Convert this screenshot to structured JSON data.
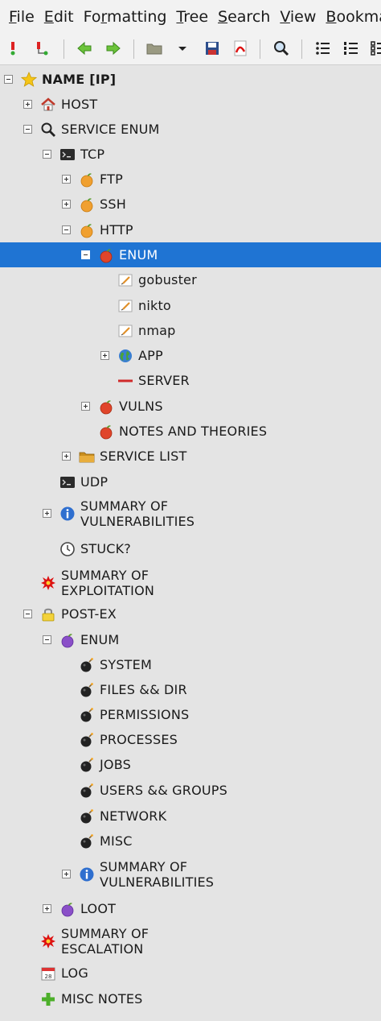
{
  "menubar": {
    "items": [
      {
        "key": "F",
        "rest": "ile"
      },
      {
        "key": "E",
        "rest": "dit"
      },
      {
        "pre": "Fo",
        "key": "r",
        "rest": "matting"
      },
      {
        "key": "T",
        "rest": "ree"
      },
      {
        "key": "S",
        "rest": "earch"
      },
      {
        "key": "V",
        "rest": "iew"
      },
      {
        "key": "B",
        "rest": "ookmar"
      }
    ]
  },
  "toolbar": {
    "icons": [
      "add-node-icon",
      "add-subnode-icon",
      "back-arrow-icon",
      "forward-arrow-icon",
      "open-folder-icon",
      "dropdown-arrow-icon",
      "save-icon",
      "export-pdf-icon",
      "find-icon",
      "bullet-list-icon",
      "numbered-list-icon",
      "todo-list-icon"
    ]
  },
  "colors": {
    "selection": "#1f74d3",
    "background": "#e4e4e4"
  },
  "tree": {
    "nodes": [
      {
        "label": "NAME [IP]",
        "icon": "star-icon",
        "expander": "minus",
        "bold": true
      },
      {
        "label": "HOST",
        "icon": "home-icon",
        "expander": "plus"
      },
      {
        "label": "SERVICE ENUM",
        "icon": "magnifier-icon",
        "expander": "minus"
      },
      {
        "label": "TCP",
        "icon": "terminal-icon",
        "expander": "minus"
      },
      {
        "label": "FTP",
        "icon": "orange-fruit-icon",
        "expander": "plus"
      },
      {
        "label": "SSH",
        "icon": "orange-fruit-icon",
        "expander": "plus"
      },
      {
        "label": "HTTP",
        "icon": "orange-fruit-icon",
        "expander": "minus"
      },
      {
        "label": "ENUM",
        "icon": "red-fruit-icon",
        "expander": "minus",
        "selected": true
      },
      {
        "label": "gobuster",
        "icon": "note-icon"
      },
      {
        "label": "nikto",
        "icon": "note-icon"
      },
      {
        "label": "nmap",
        "icon": "note-icon"
      },
      {
        "label": "APP",
        "icon": "globe-icon",
        "expander": "plus"
      },
      {
        "label": "SERVER",
        "icon": "red-dash-icon"
      },
      {
        "label": "VULNS",
        "icon": "red-fruit-icon",
        "expander": "plus"
      },
      {
        "label": "NOTES AND THEORIES",
        "icon": "red-fruit-icon"
      },
      {
        "label": "SERVICE LIST",
        "icon": "folder-icon",
        "expander": "plus"
      },
      {
        "label": "UDP",
        "icon": "terminal-icon"
      },
      {
        "label": "SUMMARY OF\nVULNERABILITIES",
        "icon": "info-icon",
        "expander": "plus"
      },
      {
        "label": "STUCK?",
        "icon": "clock-icon"
      },
      {
        "label": "SUMMARY OF\nEXPLOITATION",
        "icon": "burst-icon"
      },
      {
        "label": "POST-EX",
        "icon": "lock-icon",
        "expander": "minus"
      },
      {
        "label": "ENUM",
        "icon": "purple-fruit-icon",
        "expander": "minus"
      },
      {
        "label": "SYSTEM",
        "icon": "bomb-icon"
      },
      {
        "label": "FILES && DIR",
        "icon": "bomb-icon"
      },
      {
        "label": "PERMISSIONS",
        "icon": "bomb-icon"
      },
      {
        "label": "PROCESSES",
        "icon": "bomb-icon"
      },
      {
        "label": "JOBS",
        "icon": "bomb-icon"
      },
      {
        "label": "USERS && GROUPS",
        "icon": "bomb-icon"
      },
      {
        "label": "NETWORK",
        "icon": "bomb-icon"
      },
      {
        "label": "MISC",
        "icon": "bomb-icon"
      },
      {
        "label": "SUMMARY OF\nVULNERABILITIES",
        "icon": "info-icon",
        "expander": "plus"
      },
      {
        "label": "LOOT",
        "icon": "purple-fruit-icon",
        "expander": "plus"
      },
      {
        "label": "SUMMARY OF\nESCALATION",
        "icon": "burst-icon"
      },
      {
        "label": "LOG",
        "icon": "calendar-icon"
      },
      {
        "label": "MISC NOTES",
        "icon": "green-plus-icon"
      }
    ]
  }
}
